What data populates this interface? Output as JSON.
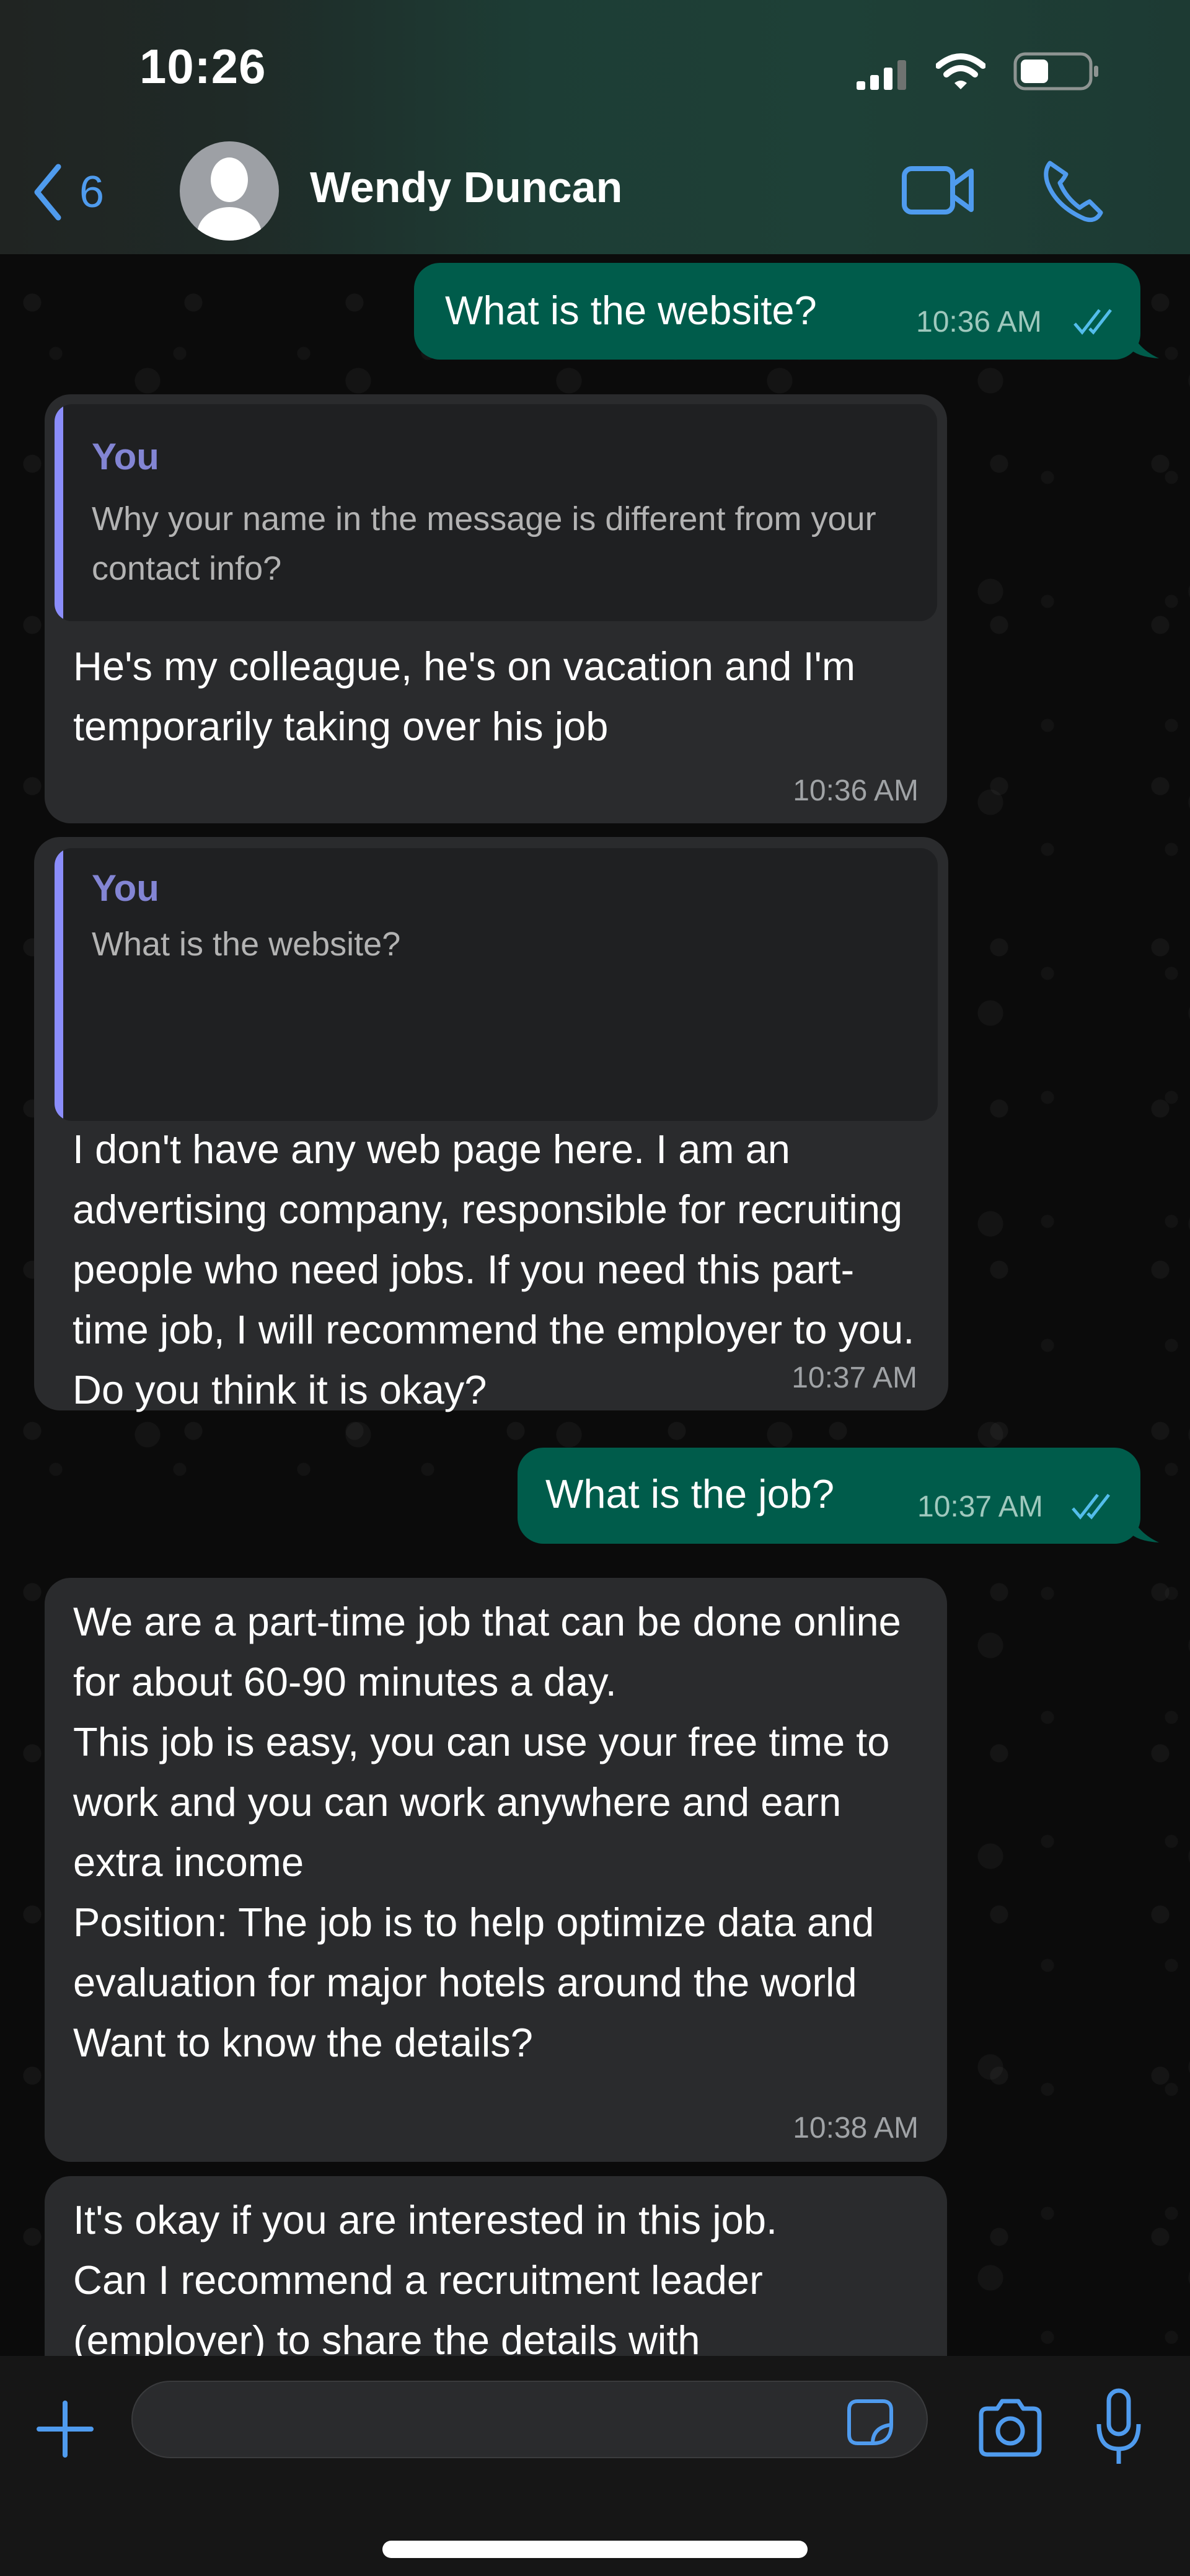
{
  "status_bar": {
    "time": "10:26",
    "signal_icon": "cellular-signal-icon",
    "wifi_icon": "wifi-icon",
    "battery_icon": "battery-icon"
  },
  "header": {
    "back_count": "6",
    "contact_name": "Wendy Duncan",
    "icons": [
      "chevron-left-icon",
      "avatar-placeholder-icon",
      "video-call-icon",
      "phone-icon"
    ]
  },
  "colors": {
    "accent": "#4f9bee",
    "sent_bubble": "#005c4b",
    "received_bubble": "#2a2b2d",
    "quote_author": "#8385d4",
    "quote_bar": "#8b8dfb",
    "read_ticks": "#53bdeb"
  },
  "messages": [
    {
      "direction": "sent",
      "text": "What is the website?",
      "time": "10:36 AM",
      "status": "read"
    },
    {
      "direction": "received",
      "quote": {
        "author": "You",
        "text": "Why your name in the message is different from your contact info?"
      },
      "text": "He's my colleague, he's on vacation and I'm temporarily taking over his job",
      "time": "10:36 AM"
    },
    {
      "direction": "received",
      "quote": {
        "author": "You",
        "text": "What is the website?"
      },
      "text": "I don't have any web page here. I am an advertising company, responsible for recruiting people who need jobs. If you need this part-time job, I will recommend the employer to you. Do you think it is okay?",
      "time": "10:37 AM"
    },
    {
      "direction": "sent",
      "text": "What is the job?",
      "time": "10:37 AM",
      "status": "read"
    },
    {
      "direction": "received",
      "text": "We are a part-time job that can be done online for about 60-90 minutes a day.\nThis job is easy, you can use your free time to work and you can work anywhere and earn extra income\nPosition: The job is to help optimize data and evaluation for major hotels around the world\nWant to know the details?",
      "time": "10:38 AM"
    },
    {
      "direction": "received",
      "text": "It's okay if you are interested in this job.\nCan I recommend a recruitment leader (employer) to share the details with",
      "time": ""
    }
  ],
  "input_bar": {
    "placeholder": "",
    "icons": [
      "plus-icon",
      "sticker-icon",
      "camera-icon",
      "microphone-icon"
    ]
  }
}
